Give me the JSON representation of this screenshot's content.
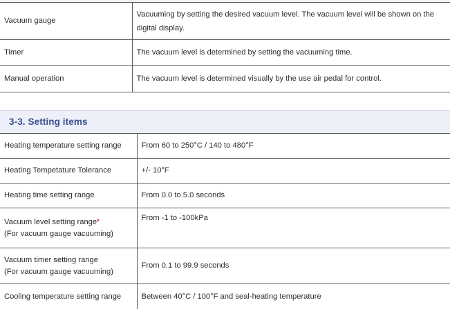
{
  "method_table": {
    "rows": [
      {
        "label": "Vacuum gauge",
        "value": "Vacuuming by setting the desired vacuum level. The vacuum level will be shown on the digital display."
      },
      {
        "label": "Timer",
        "value": "The vacuum level is determined by setting the vacuuming time."
      },
      {
        "label": "Manual operation",
        "value": "The vacuum level is determined visually by the use air pedal for control."
      }
    ]
  },
  "section": {
    "title": "3-3. Setting items"
  },
  "settings_table": {
    "rows": [
      {
        "label": "Heating temperature setting range",
        "value": "From 60 to 250°C / 140 to 480°F"
      },
      {
        "label": "Heating Tempetature Tolerance",
        "value": "+/- 10°F"
      },
      {
        "label": "Heating time setting range",
        "value": "From 0.0 to 5.0 seconds"
      },
      {
        "label": "Vacuum level setting range",
        "asterisk": "*",
        "label_sub": "(For vacuum gauge vacuuming)",
        "value": "From -1 to -100kPa"
      },
      {
        "label": "Vacuum timer setting range",
        "label_sub": "(For vacuum gauge vacuuming)",
        "value": "From 0.1 to 99.9 seconds"
      },
      {
        "label": "Cooling temperature setting range",
        "value": "Between 40°C / 100°F and seal-heating temperature"
      }
    ]
  }
}
